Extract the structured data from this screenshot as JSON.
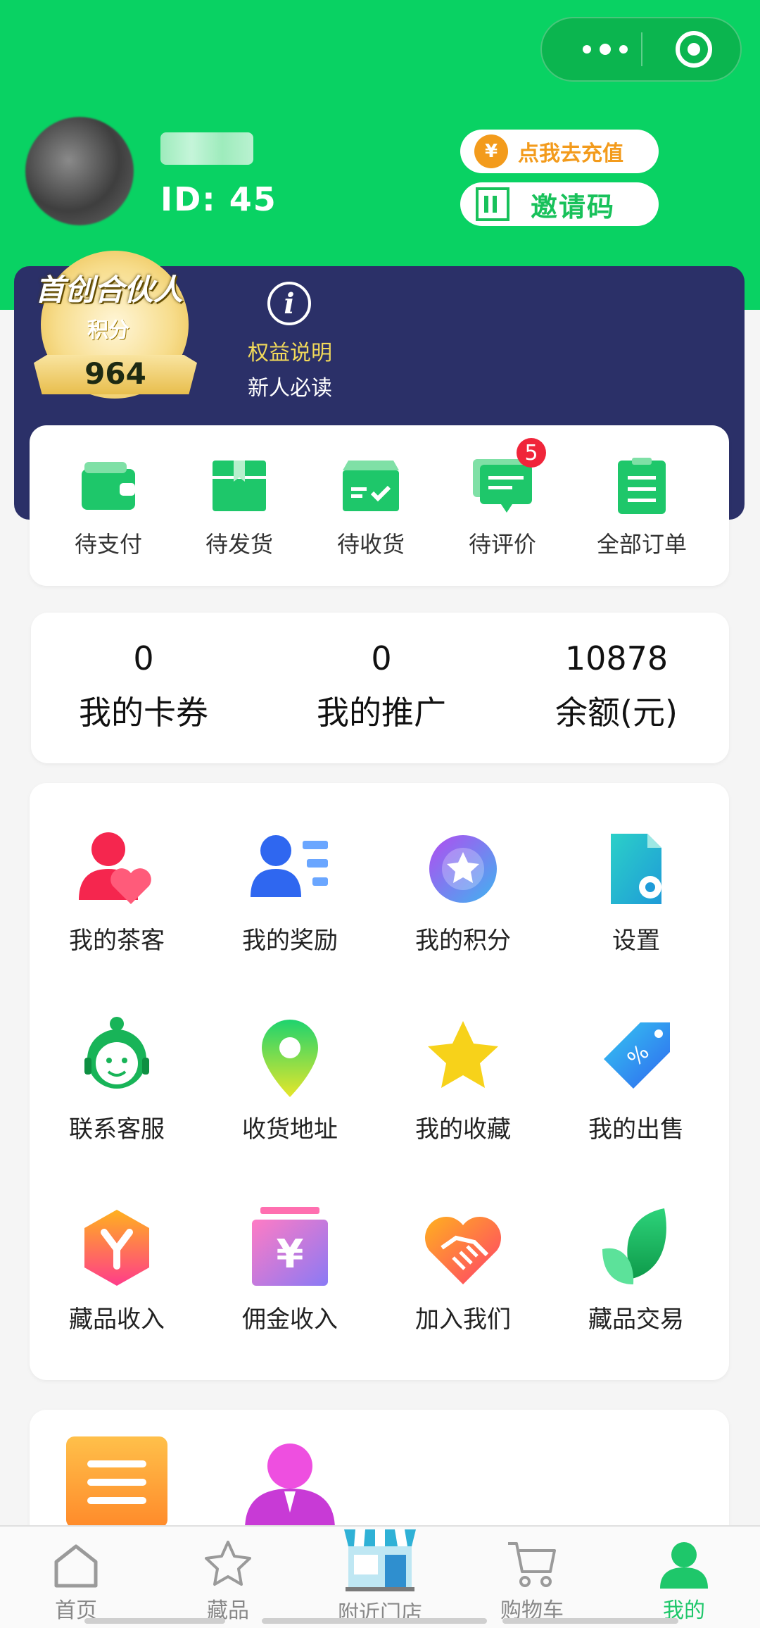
{
  "colors": {
    "brand_green": "#09d263",
    "navy": "#2b3068",
    "orange": "#f39b1c",
    "badge_red": "#f0253a",
    "active_tab": "#1ec76a"
  },
  "capsule": {
    "more_icon": "more-dots-icon",
    "close_icon": "target-circle-icon"
  },
  "user": {
    "id_text": "ID: 45",
    "recharge_label": "点我去充值",
    "invite_label": "邀请码"
  },
  "partner": {
    "title": "首创合伙人",
    "points_label": "积分",
    "points_value": "964",
    "rights_label": "权益说明",
    "newbie_label": "新人必读"
  },
  "orders": [
    {
      "label": "待支付",
      "icon": "wallet-icon"
    },
    {
      "label": "待发货",
      "icon": "package-icon"
    },
    {
      "label": "待收货",
      "icon": "delivery-box-icon"
    },
    {
      "label": "待评价",
      "icon": "comment-icon",
      "badge": "5"
    },
    {
      "label": "全部订单",
      "icon": "clipboard-icon"
    }
  ],
  "stats": [
    {
      "value": "0",
      "label": "我的卡券"
    },
    {
      "value": "0",
      "label": "我的推广"
    },
    {
      "value": "10878",
      "label": "余额(元)"
    }
  ],
  "menu": [
    {
      "label": "我的茶客",
      "icon": "user-heart-icon"
    },
    {
      "label": "我的奖励",
      "icon": "user-list-icon"
    },
    {
      "label": "我的积分",
      "icon": "star-badge-icon"
    },
    {
      "label": "设置",
      "icon": "settings-doc-icon"
    },
    {
      "label": "联系客服",
      "icon": "customer-service-icon"
    },
    {
      "label": "收货地址",
      "icon": "location-pin-icon"
    },
    {
      "label": "我的收藏",
      "icon": "star-icon"
    },
    {
      "label": "我的出售",
      "icon": "price-tag-icon"
    },
    {
      "label": "藏品收入",
      "icon": "yen-hexagon-icon"
    },
    {
      "label": "佣金收入",
      "icon": "yen-box-icon"
    },
    {
      "label": "加入我们",
      "icon": "handshake-icon"
    },
    {
      "label": "藏品交易",
      "icon": "leaf-icon"
    }
  ],
  "tabs": [
    {
      "label": "首页",
      "icon": "home-icon"
    },
    {
      "label": "藏品",
      "icon": "star-outline-icon"
    },
    {
      "label": "附近门店",
      "icon": "store-icon"
    },
    {
      "label": "购物车",
      "icon": "cart-icon"
    },
    {
      "label": "我的",
      "icon": "profile-icon",
      "active": true
    }
  ]
}
